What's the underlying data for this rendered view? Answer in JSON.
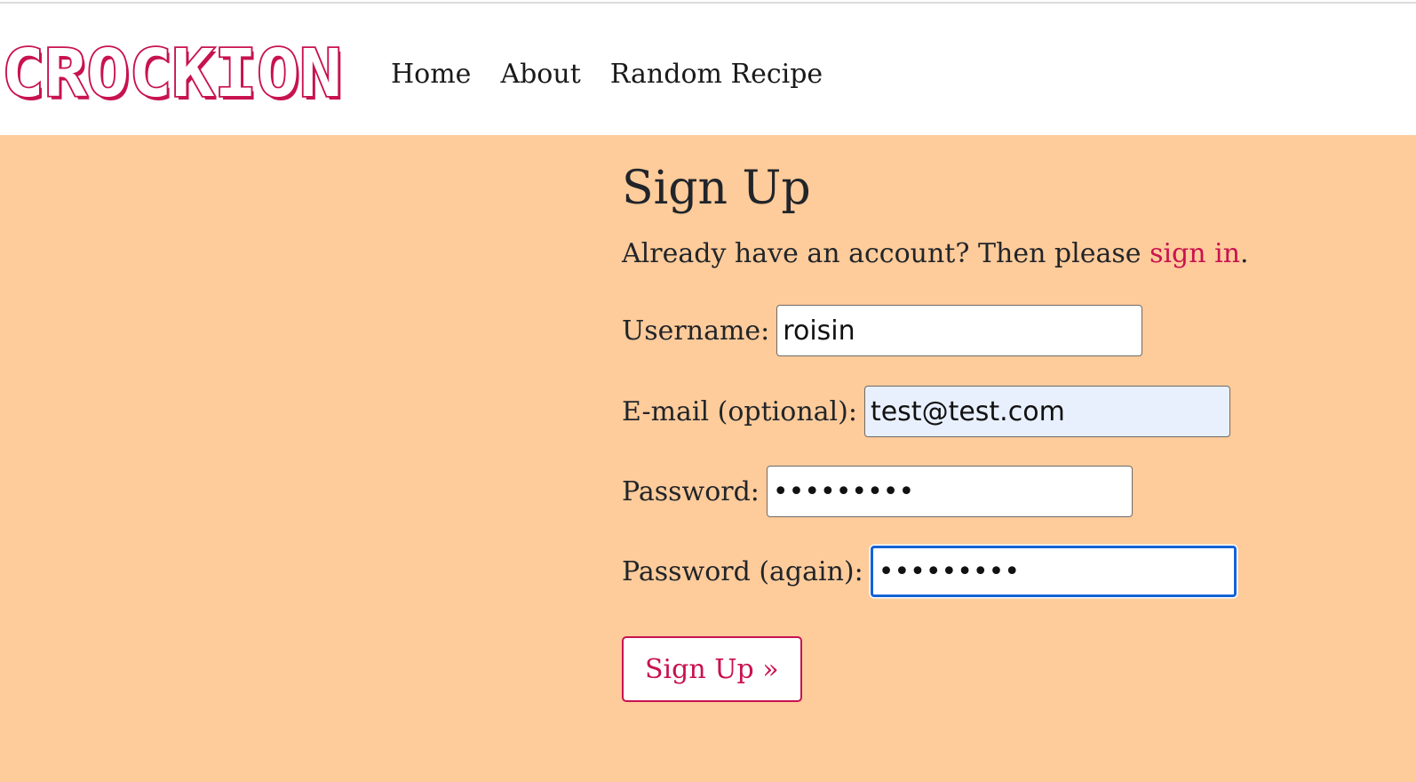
{
  "brand": {
    "logo_text": "CROCKION",
    "color": "#c8124f"
  },
  "nav": {
    "items": [
      {
        "label": "Home"
      },
      {
        "label": "About"
      },
      {
        "label": "Random Recipe"
      }
    ]
  },
  "main": {
    "background": "#fecb9b",
    "title": "Sign Up",
    "intro_prefix": "Already have an account? Then please ",
    "intro_link": "sign in",
    "intro_suffix": "."
  },
  "form": {
    "username": {
      "label": "Username:",
      "value": "roisin"
    },
    "email": {
      "label": "E-mail (optional):",
      "value": "test@test.com"
    },
    "password": {
      "label": "Password:",
      "value": "•••••••••"
    },
    "password2": {
      "label": "Password (again):",
      "value": "•••••••••"
    },
    "submit_label": "Sign Up »"
  }
}
